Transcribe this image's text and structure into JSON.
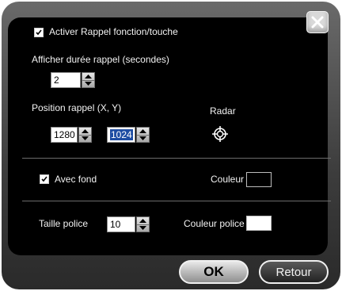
{
  "header": {
    "checkbox_checked": true,
    "label": "Activer Rappel fonction/touche"
  },
  "duration": {
    "label": "Afficher durée rappel (secondes)",
    "value": "2"
  },
  "position": {
    "label": "Position rappel (X, Y)",
    "x_value": "1280",
    "y_value": "1024",
    "radar_label": "Radar",
    "radar_icon": "crosshair-target-icon"
  },
  "background": {
    "checkbox_checked": true,
    "label": "Avec fond",
    "color_label": "Couleur",
    "color_value": "#000000"
  },
  "font": {
    "size_label": "Taille police",
    "size_value": "10",
    "color_label": "Couleur police",
    "color_value": "#ffffff"
  },
  "buttons": {
    "ok_label": "OK",
    "back_label": "Retour"
  },
  "icons": {
    "close": "close-icon",
    "spinner_up": "arrow-up-icon",
    "spinner_down": "arrow-down-icon",
    "check": "checkmark-icon"
  }
}
